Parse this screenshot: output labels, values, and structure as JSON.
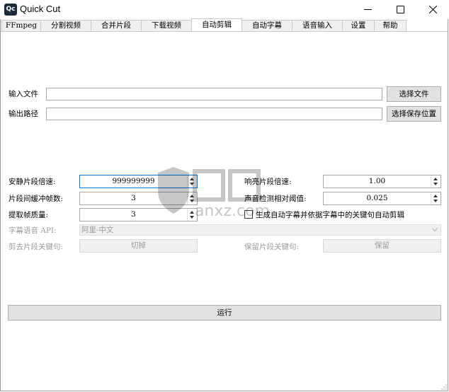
{
  "window": {
    "app_icon_text": "Qc",
    "title": "Quick Cut",
    "minimize_icon": "minimize-icon",
    "maximize_icon": "maximize-icon",
    "close_icon": "close-icon"
  },
  "tabs": [
    {
      "label": "FFmpeg",
      "active": false
    },
    {
      "label": "分割视频",
      "active": false
    },
    {
      "label": "合并片段",
      "active": false
    },
    {
      "label": "下载视频",
      "active": false
    },
    {
      "label": "自动剪辑",
      "active": true
    },
    {
      "label": "自动字幕",
      "active": false
    },
    {
      "label": "语音输入",
      "active": false
    },
    {
      "label": "设置",
      "active": false
    },
    {
      "label": "帮助",
      "active": false
    }
  ],
  "files": {
    "input_label": "输入文件",
    "input_value": "",
    "input_button": "选择文件",
    "output_label": "输出路径",
    "output_value": "",
    "output_button": "选择保存位置"
  },
  "params": {
    "silent_speed_label": "安静片段倍速:",
    "silent_speed_value": "999999999",
    "loud_speed_label": "响亮片段倍速:",
    "loud_speed_value": "1.00",
    "buffer_frames_label": "片段间缓冲帧数:",
    "buffer_frames_value": "3",
    "threshold_label": "声音检测相对阈值:",
    "threshold_value": "0.025",
    "frame_quality_label": "提取帧质量:",
    "frame_quality_value": "3",
    "subtitle_checkbox_label": "生成自动字幕并依据字幕中的关键句自动剪辑",
    "subtitle_checked": false,
    "subtitle_api_label": "字幕语音 API:",
    "subtitle_api_value": "阿里-中文",
    "cut_keyword_label": "剪去片段关键句:",
    "cut_keyword_button": "切掉",
    "keep_keyword_label": "保留片段关键句:",
    "keep_keyword_button": "保留"
  },
  "run_button": "运行",
  "watermark_text": "anxz.com",
  "colors": {
    "focus_border": "#0078d7",
    "disabled_text": "#9a9a9a"
  }
}
